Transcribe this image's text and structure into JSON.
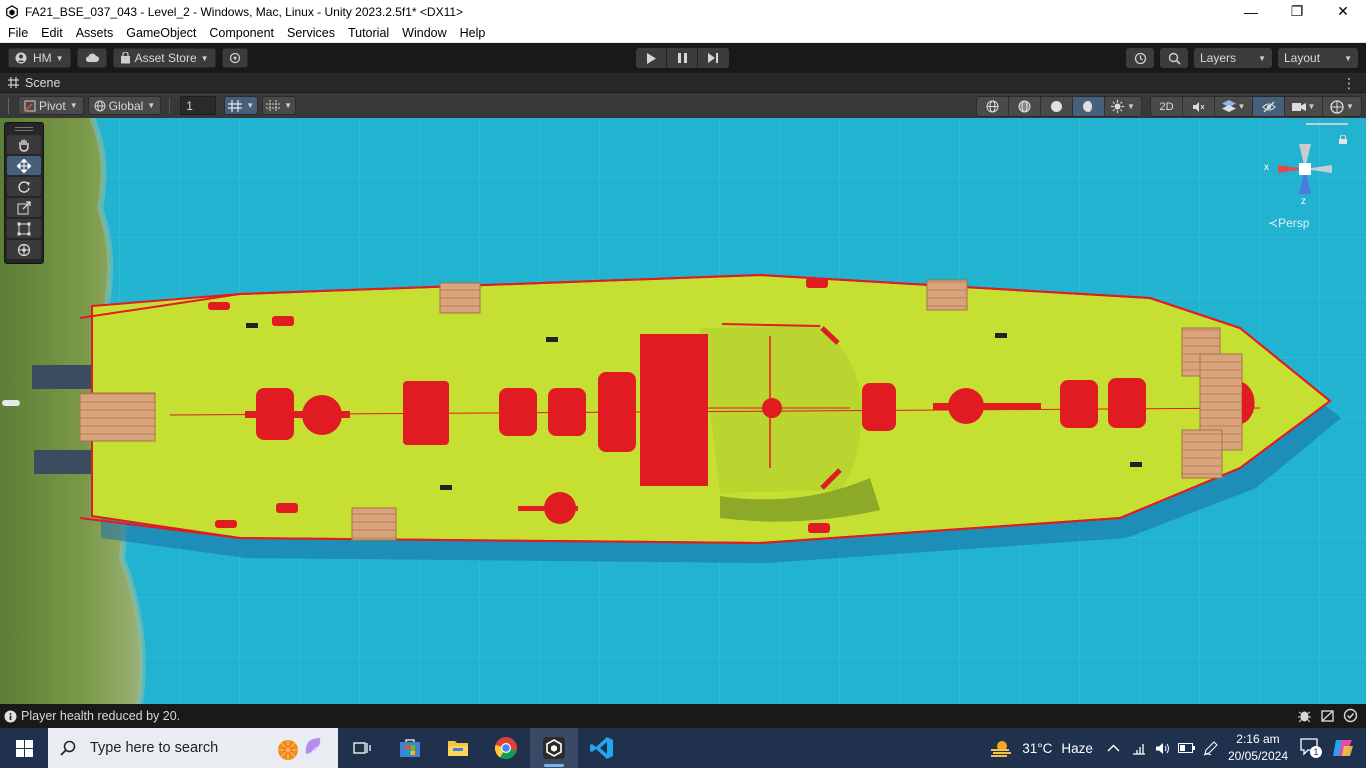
{
  "window": {
    "title": "FA21_BSE_037_043 - Level_2 - Windows, Mac, Linux - Unity 2023.2.5f1* <DX11>",
    "minimize": "—",
    "maximize": "❐",
    "close": "✕"
  },
  "menu": [
    "File",
    "Edit",
    "Assets",
    "GameObject",
    "Component",
    "Services",
    "Tutorial",
    "Window",
    "Help"
  ],
  "toolbar": {
    "account": "HM",
    "asset_store": "Asset Store",
    "layers": "Layers",
    "layout": "Layout"
  },
  "scene_tab": {
    "label": "Scene"
  },
  "scene_toolbar": {
    "pivot": "Pivot",
    "global": "Global",
    "grid_value": "1",
    "mode_2d": "2D"
  },
  "gizmo": {
    "label": "Persp",
    "x_axis": "x",
    "z_axis": "z"
  },
  "status": {
    "message": "Player health reduced by 20."
  },
  "taskbar": {
    "search_placeholder": "Type here to search",
    "weather_temp": "31°C",
    "weather_desc": "Haze",
    "time": "2:16 am",
    "date": "20/05/2024",
    "notification_count": "1"
  },
  "colors": {
    "water": "#21b3cf",
    "deck": "#c5e033",
    "red": "#e11b22",
    "crate": "#d9a47b",
    "grass": "#6f8f3a"
  }
}
